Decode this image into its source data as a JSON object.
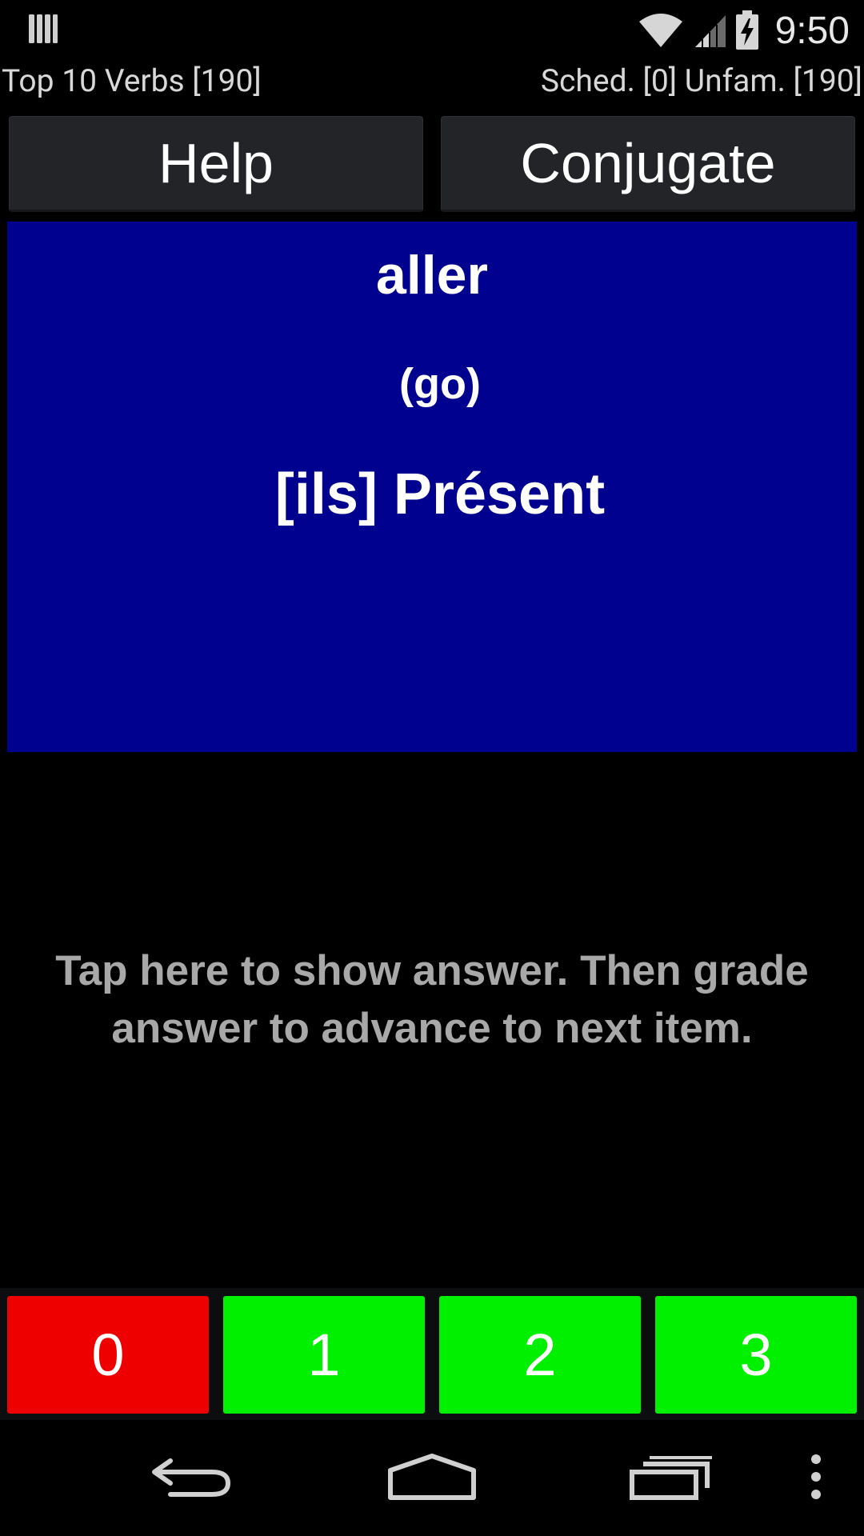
{
  "status_bar": {
    "time": "9:50",
    "notification_icon": "notification-bars-icon",
    "wifi_icon": "wifi-icon",
    "signal_icon": "cell-signal-icon",
    "battery_icon": "battery-charging-icon"
  },
  "info": {
    "deck_label": "Top 10 Verbs [190]",
    "counts_label": "Sched. [0] Unfam. [190]"
  },
  "top_buttons": {
    "help_label": "Help",
    "conjugate_label": "Conjugate"
  },
  "card": {
    "verb": "aller",
    "translation": "(go)",
    "prompt": "[ils] Présent",
    "background_color": "#010190"
  },
  "answer_area": {
    "hint": "Tap here to show answer. Then grade answer to advance to next item."
  },
  "grade_buttons": [
    {
      "label": "0",
      "color": "#ee0000"
    },
    {
      "label": "1",
      "color": "#00f000"
    },
    {
      "label": "2",
      "color": "#00f000"
    },
    {
      "label": "3",
      "color": "#00f000"
    }
  ],
  "nav_bar": {
    "back_icon": "back-icon",
    "home_icon": "home-icon",
    "recents_icon": "recent-apps-icon",
    "menu_icon": "overflow-menu-icon"
  }
}
